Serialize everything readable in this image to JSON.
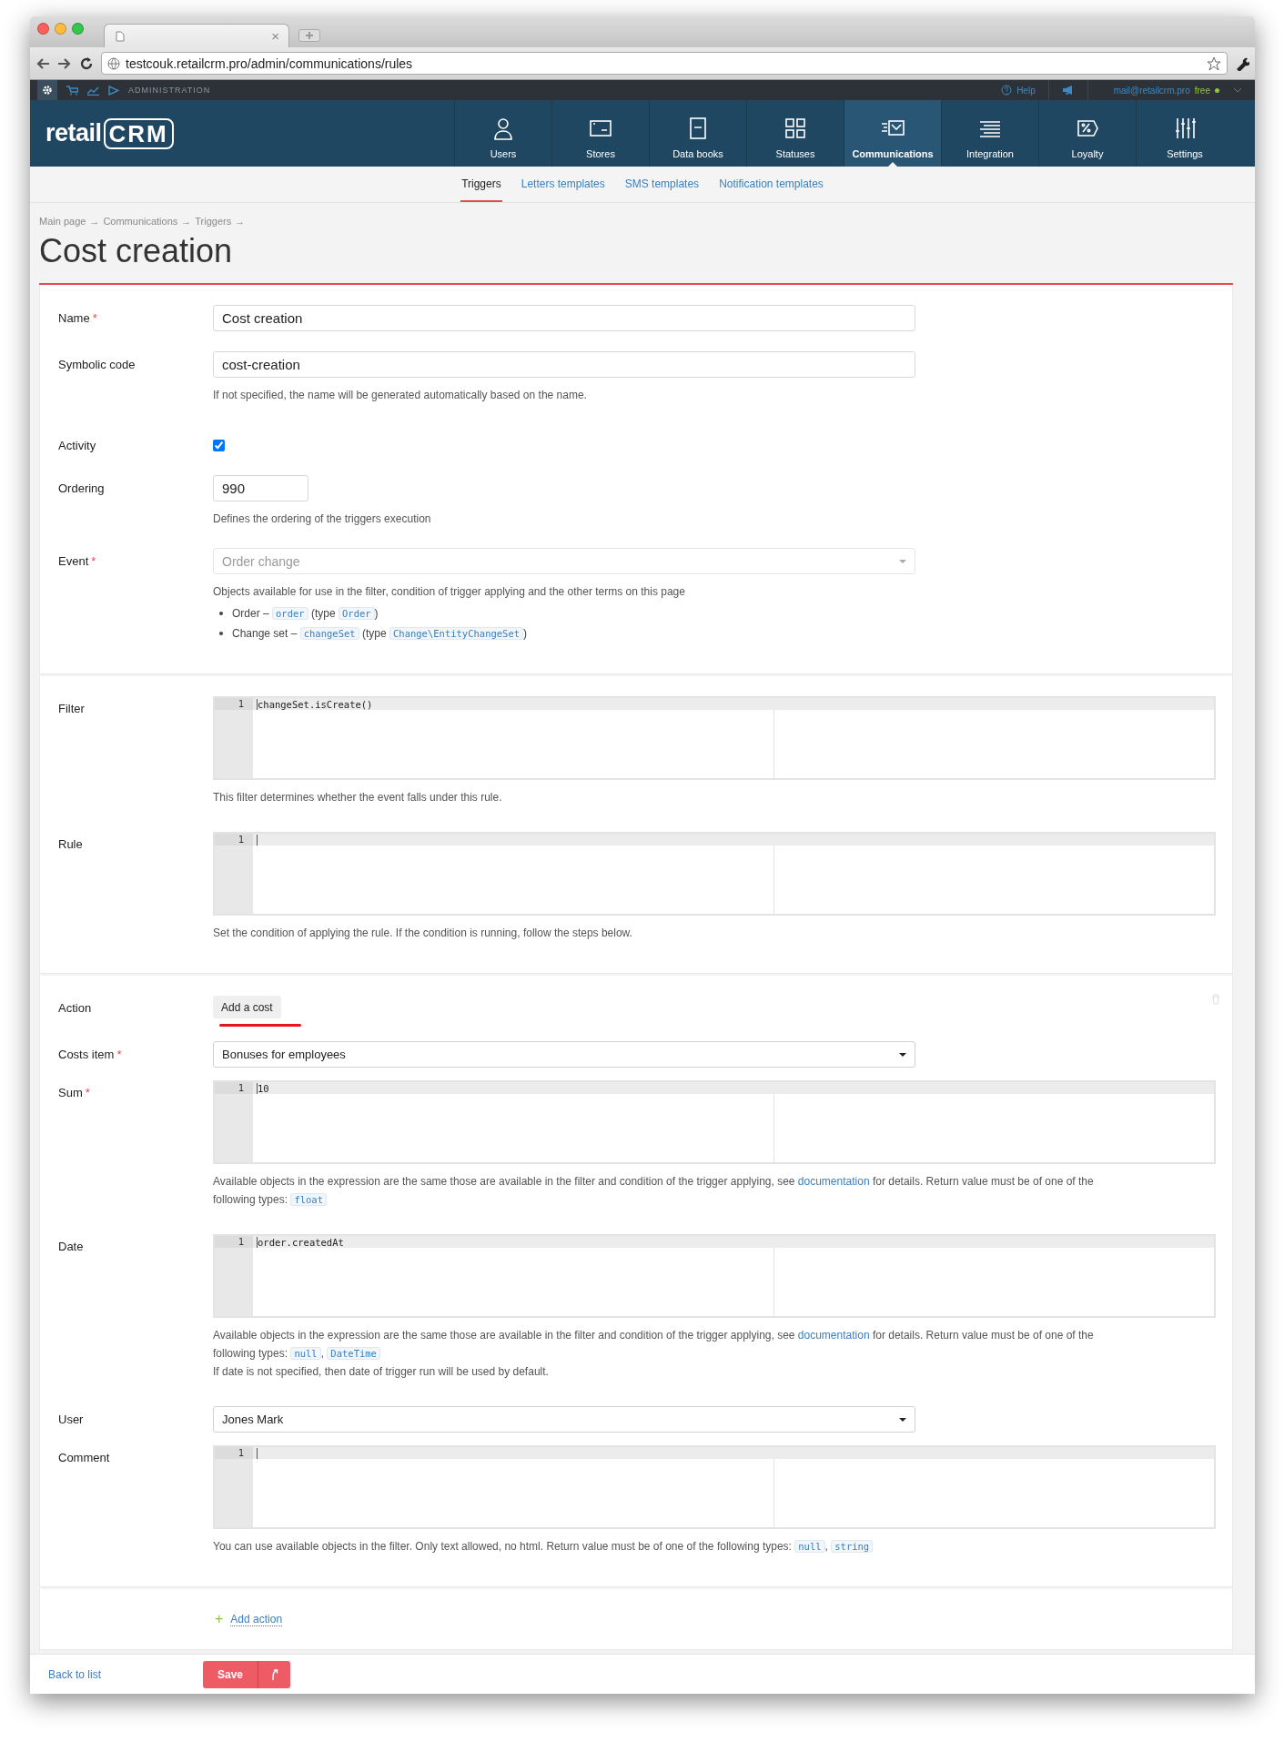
{
  "browser": {
    "tab_close": "×",
    "url": "testcouk.retailcrm.pro/admin/communications/rules"
  },
  "admin_bar": {
    "section": "ADMINISTRATION",
    "help": "Help",
    "account": "mail@retailcrm.pro",
    "plan": "free"
  },
  "logo": {
    "word": "retail",
    "mark": "CRM"
  },
  "nav": [
    {
      "label": "Users",
      "selected": false
    },
    {
      "label": "Stores",
      "selected": false
    },
    {
      "label": "Data books",
      "selected": false
    },
    {
      "label": "Statuses",
      "selected": false
    },
    {
      "label": "Communications",
      "selected": true
    },
    {
      "label": "Integration",
      "selected": false
    },
    {
      "label": "Loyalty",
      "selected": false
    },
    {
      "label": "Settings",
      "selected": false
    }
  ],
  "subtabs": [
    {
      "label": "Triggers",
      "selected": true
    },
    {
      "label": "Letters templates",
      "selected": false
    },
    {
      "label": "SMS templates",
      "selected": false
    },
    {
      "label": "Notification templates",
      "selected": false
    }
  ],
  "breadcrumbs": [
    "Main page",
    "Communications",
    "Triggers"
  ],
  "breadcrumb_separator": "→",
  "title": "Cost creation",
  "sections": [
    {
      "fields": [
        {
          "kind": "text",
          "label": "Name",
          "required_mark": "*",
          "value": "Cost creation"
        },
        {
          "kind": "text",
          "label": "Symbolic code",
          "value": "cost-creation",
          "help": [
            [
              {
                "t": "If not specified, the name will be generated automatically based on the name."
              }
            ]
          ]
        },
        {
          "kind": "checkbox",
          "label": "Activity",
          "checked": true
        },
        {
          "kind": "number",
          "label": "Ordering",
          "value": "990",
          "help": [
            [
              {
                "t": "Defines the ordering of the triggers execution"
              }
            ]
          ]
        },
        {
          "kind": "select",
          "label": "Event",
          "required_mark": "*",
          "value": "Order change",
          "disabled": true,
          "help": [
            [
              {
                "t": "Objects available for use in the filter, condition of trigger applying and the other terms on this page"
              }
            ]
          ],
          "objects": [
            [
              {
                "t": "Order – "
              },
              {
                "code": "order"
              },
              {
                "t": " (type "
              },
              {
                "code": "Order"
              },
              {
                "t": ")"
              }
            ],
            [
              {
                "t": "Change set – "
              },
              {
                "code": "changeSet"
              },
              {
                "t": " (type "
              },
              {
                "code": "Change\\EntityChangeSet"
              },
              {
                "t": ")"
              }
            ]
          ]
        }
      ]
    },
    {
      "fields": [
        {
          "kind": "code",
          "label": "Filter",
          "lines": [
            {
              "number": "1",
              "text": "changeSet.isCreate()"
            }
          ],
          "help": [
            [
              {
                "t": "This filter determines whether the event falls under this rule."
              }
            ]
          ]
        },
        {
          "kind": "code",
          "label": "Rule",
          "lines": [
            {
              "number": "1"
            }
          ],
          "help": [
            [
              {
                "t": "Set the condition of applying the rule. If the condition is running, follow the steps below."
              }
            ]
          ]
        }
      ]
    },
    {
      "removable": true,
      "fields": [
        {
          "kind": "action",
          "label": "Action",
          "button": "Add a cost",
          "selected": true
        },
        {
          "kind": "select",
          "label": "Costs item",
          "required_mark": "*",
          "value": "Bonuses for employees",
          "disabled": false
        },
        {
          "kind": "code",
          "label": "Sum",
          "required_mark": "*",
          "lines": [
            {
              "number": "1",
              "text": "10"
            }
          ],
          "help": [
            [
              {
                "t": "Available objects in the expression are the same those are available in the filter and condition of the trigger applying, see "
              },
              {
                "link": "documentation"
              },
              {
                "t": " for details. Return value must be of one of the following types: "
              },
              {
                "code": "float"
              }
            ]
          ]
        },
        {
          "kind": "code",
          "label": "Date",
          "lines": [
            {
              "number": "1",
              "text": "order.createdAt"
            }
          ],
          "help": [
            [
              {
                "t": "Available objects in the expression are the same those are available in the filter and condition of the trigger applying, see "
              },
              {
                "link": "documentation"
              },
              {
                "t": " for details. Return value must be of one of the following types: "
              },
              {
                "code": "null"
              },
              {
                "t": ", "
              },
              {
                "code": "DateTime"
              }
            ],
            [
              {
                "t": "If date is not specified, then date of trigger run will be used by default."
              }
            ]
          ]
        },
        {
          "kind": "select",
          "label": "User",
          "value": "Jones Mark",
          "disabled": false
        },
        {
          "kind": "code",
          "label": "Comment",
          "lines": [
            {
              "number": "1"
            }
          ],
          "help": [
            [
              {
                "t": "You can use available objects in the filter. Only text allowed, no html. Return value must be of one of the following types: "
              },
              {
                "code": "null"
              },
              {
                "t": ", "
              },
              {
                "code": "string"
              }
            ]
          ]
        }
      ]
    }
  ],
  "add_action": {
    "icon": "+",
    "label": "Add action"
  },
  "footer": {
    "back": "Back to list",
    "save": "Save"
  }
}
